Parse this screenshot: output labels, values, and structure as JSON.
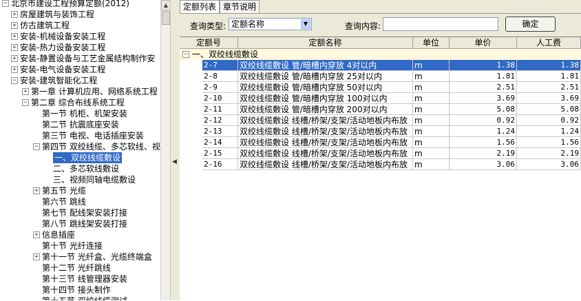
{
  "tree": {
    "items": [
      {
        "label": "北京市建设工程预算定额(2012)",
        "toggle": "−",
        "level": 0
      },
      {
        "label": "房屋建筑与装饰工程",
        "toggle": "+",
        "level": 1
      },
      {
        "label": "仿古建筑工程",
        "toggle": "+",
        "level": 1
      },
      {
        "label": "安装-机械设备安装工程",
        "toggle": "+",
        "level": 1
      },
      {
        "label": "安装-热力设备安装工程",
        "toggle": "+",
        "level": 1
      },
      {
        "label": "安装-静置设备与工艺金属结构制作安",
        "toggle": "+",
        "level": 1
      },
      {
        "label": "安装-电气设备安装工程",
        "toggle": "+",
        "level": 1
      },
      {
        "label": "安装-建筑智能化工程",
        "toggle": "−",
        "level": 1
      },
      {
        "label": "第一章 计算机应用、网络系统工程",
        "toggle": "+",
        "level": 2
      },
      {
        "label": "第二章 综合布线系统工程",
        "toggle": "−",
        "level": 2
      },
      {
        "label": "第一节 机柜、机架安装",
        "toggle": "",
        "level": 3
      },
      {
        "label": "第二节 抗震底座安装",
        "toggle": "",
        "level": 3
      },
      {
        "label": "第三节 电视、电话插座安装",
        "toggle": "",
        "level": 3
      },
      {
        "label": "第四节 双绞线缆、多芯软线、视",
        "toggle": "−",
        "level": 3
      },
      {
        "label": "一、双绞线缆敷设",
        "toggle": "",
        "level": 4,
        "selected": true
      },
      {
        "label": "二、多芯软线敷设",
        "toggle": "",
        "level": 4
      },
      {
        "label": "三、视频同轴电缆敷设",
        "toggle": "",
        "level": 4
      },
      {
        "label": "第五节 光缆",
        "toggle": "+",
        "level": 3
      },
      {
        "label": "第六节 跳线",
        "toggle": "",
        "level": 3
      },
      {
        "label": "第七节 配线架安装打接",
        "toggle": "",
        "level": 3
      },
      {
        "label": "第八节 跳线架安装打接",
        "toggle": "",
        "level": 3
      },
      {
        "label": "信息插座",
        "toggle": "+",
        "level": 3
      },
      {
        "label": "第十节 光纤连接",
        "toggle": "",
        "level": 3
      },
      {
        "label": "第十一节 光纤盒、光缆终端盒",
        "toggle": "+",
        "level": 3
      },
      {
        "label": "第十二节 光纤跳线",
        "toggle": "",
        "level": 3
      },
      {
        "label": "第十三节 线管理器安装",
        "toggle": "",
        "level": 3
      },
      {
        "label": "第十四节 接头制作",
        "toggle": "",
        "level": 3
      },
      {
        "label": "第十五节 双绞线缆测试",
        "toggle": "",
        "level": 3
      }
    ]
  },
  "tabs": [
    {
      "label": "定额列表",
      "active": true
    },
    {
      "label": "章节说明",
      "active": false
    }
  ],
  "query": {
    "type_label": "查询类型:",
    "type_value": "定额名称",
    "content_label": "查询内容:",
    "content_value": "",
    "confirm_label": "确定"
  },
  "grid": {
    "columns": [
      "定额号",
      "定额名称",
      "单位",
      "单价",
      "人工费"
    ],
    "group": {
      "toggle": "−",
      "label": "一、双绞线缆敷设"
    },
    "rows": [
      {
        "code": "2-7",
        "name": "双绞线缆敷设 管/暗槽内穿放 4对以内",
        "unit": "m",
        "price": "1.38",
        "labor": "1.38",
        "selected": true
      },
      {
        "code": "2-8",
        "name": "双绞线缆敷设 管/暗槽内穿放 25对以内",
        "unit": "m",
        "price": "1.81",
        "labor": "1.81"
      },
      {
        "code": "2-9",
        "name": "双绞线缆敷设 管/暗槽内穿放 50对以内",
        "unit": "m",
        "price": "2.51",
        "labor": "2.51"
      },
      {
        "code": "2-10",
        "name": "双绞线缆敷设 管/暗槽内穿放 100对以内",
        "unit": "m",
        "price": "3.69",
        "labor": "3.69"
      },
      {
        "code": "2-11",
        "name": "双绞线缆敷设 管/暗槽内穿放 200对以内",
        "unit": "m",
        "price": "5.08",
        "labor": "5.08"
      },
      {
        "code": "2-12",
        "name": "双绞线缆敷设 线槽/桥架/支架/活动地板内布放",
        "unit": "m",
        "price": "0.92",
        "labor": "0.92"
      },
      {
        "code": "2-13",
        "name": "双绞线缆敷设 线槽/桥架/支架/活动地板内布放",
        "unit": "m",
        "price": "1.24",
        "labor": "1.24"
      },
      {
        "code": "2-14",
        "name": "双绞线缆敷设 线槽/桥架/支架/活动地板内布放",
        "unit": "m",
        "price": "1.56",
        "labor": "1.56"
      },
      {
        "code": "2-15",
        "name": "双绞线缆敷设 线槽/桥架/支架/活动地板内布放",
        "unit": "m",
        "price": "2.19",
        "labor": "2.19"
      },
      {
        "code": "2-16",
        "name": "双绞线缆敷设 线槽/桥架/支架/活动地板内布放",
        "unit": "m",
        "price": "3.06",
        "labor": "3.06"
      }
    ]
  },
  "icons": {
    "scroll_up": "chevron-up-icon",
    "splitter": "chevron-left-icon",
    "dropdown": "chevron-down-icon"
  }
}
